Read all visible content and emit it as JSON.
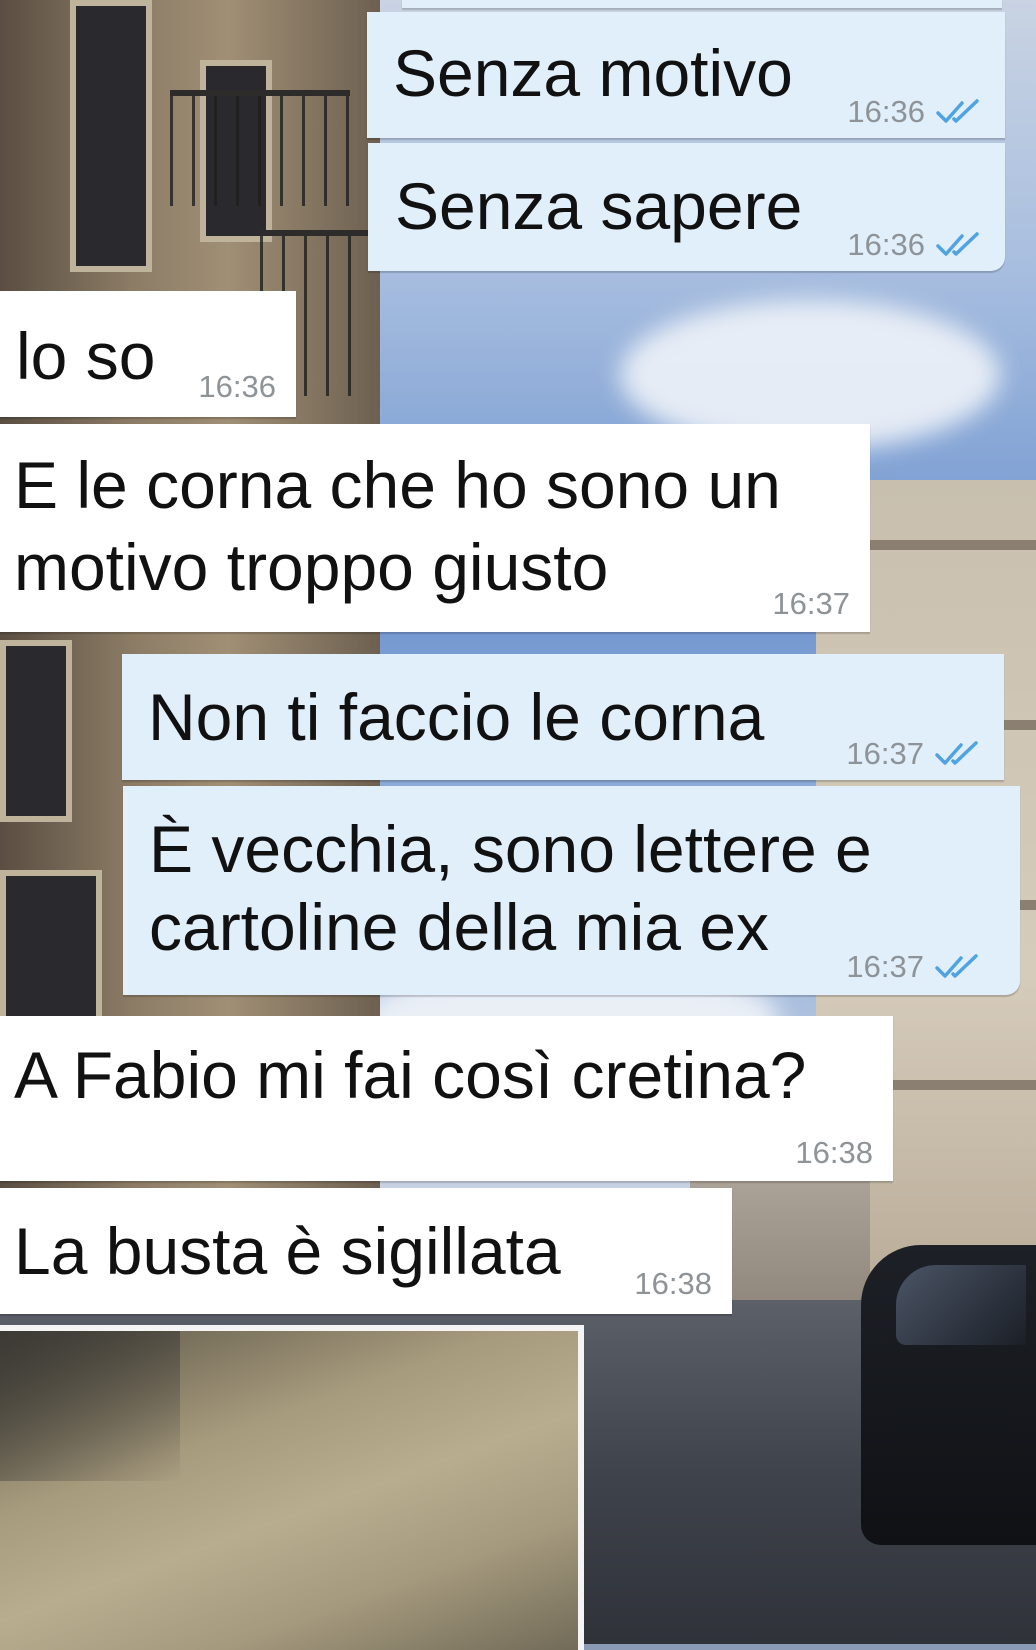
{
  "colors": {
    "incoming_bubble": "#ffffff",
    "outgoing_bubble": "#e1effb",
    "timestamp": "#8e9398",
    "read_ticks": "#4fa3e0"
  },
  "messages": [
    {
      "direction": "outgoing",
      "text": "Senza motivo",
      "time": "16:36",
      "status_icon": "double-check-icon"
    },
    {
      "direction": "outgoing",
      "text": "Senza sapere",
      "time": "16:36",
      "status_icon": "double-check-icon"
    },
    {
      "direction": "incoming",
      "text": "lo so",
      "time": "16:36"
    },
    {
      "direction": "incoming",
      "lines": [
        "E le corna che ho sono un",
        "motivo troppo giusto"
      ],
      "time": "16:37"
    },
    {
      "direction": "outgoing",
      "text": "Non ti faccio le corna",
      "time": "16:37",
      "status_icon": "double-check-icon"
    },
    {
      "direction": "outgoing",
      "lines": [
        "È vecchia, sono lettere e",
        "cartoline della mia ex"
      ],
      "time": "16:37",
      "status_icon": "double-check-icon"
    },
    {
      "direction": "incoming",
      "text": "A Fabio mi fai così cretina?",
      "time": "16:38"
    },
    {
      "direction": "incoming",
      "text": "La busta è sigillata",
      "time": "16:38"
    }
  ]
}
